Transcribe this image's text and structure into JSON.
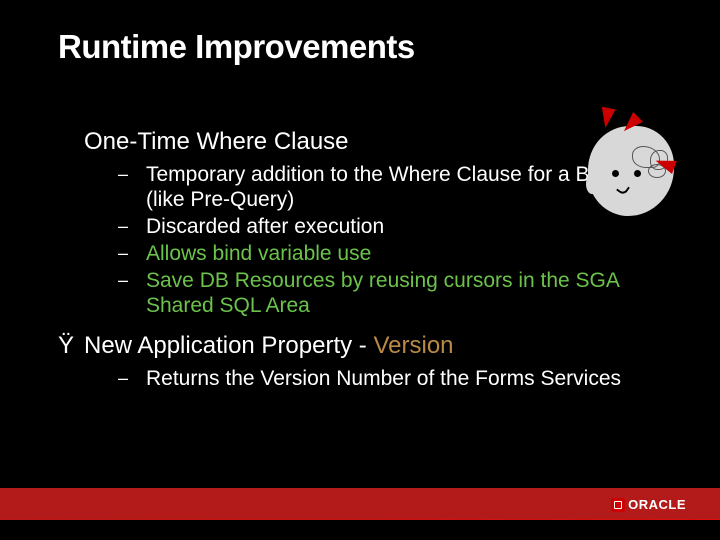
{
  "title": "Runtime Improvements",
  "topics": [
    {
      "bullet": "",
      "label": "One-Time Where Clause",
      "items": [
        {
          "text": "Temporary addition to the Where Clause for a Block (like Pre-Query)"
        },
        {
          "text": "Discarded after execution"
        },
        {
          "text": "Allows bind variable use",
          "green": true
        },
        {
          "text": "Save DB Resources by reusing cursors in the SGA Shared SQL Area",
          "green": true
        }
      ]
    },
    {
      "bullet": "Ÿ",
      "label_prefix": "New Application Property - ",
      "label_link": "Version",
      "items": [
        {
          "text": "Returns the Version Number of the Forms Services"
        }
      ]
    }
  ],
  "logo_text": "ORACLE"
}
